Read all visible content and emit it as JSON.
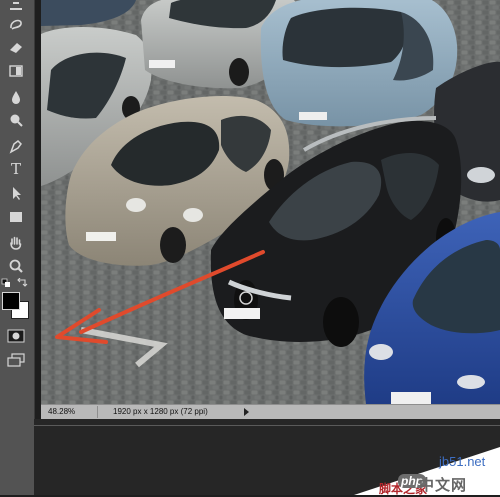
{
  "status_bar": {
    "zoom": "48.28%",
    "document_info": "1920 px x 1280 px (72 ppi)"
  },
  "toolbar": {
    "tools": [
      "move-icon",
      "lasso-icon",
      "brush-icon",
      "eraser-icon",
      "gradient-icon",
      "blur-drop-icon",
      "dodge-icon",
      "pen-icon",
      "type-icon",
      "path-select-icon",
      "rectangle-icon",
      "hand-icon",
      "zoom-icon",
      "default-colors-icon",
      "swap-colors-icon",
      "foreground-color-swatch",
      "background-color-swatch",
      "quick-mask-icon",
      "screen-mode-icon"
    ],
    "type_tool_label": "T",
    "foreground_color": "#000000",
    "background_color": "#ffffff"
  },
  "annotation": {
    "arrow_color": "#e04a2c"
  },
  "watermark": {
    "badge": "php",
    "site": "jb51.net",
    "site_cn": "中文网",
    "brand": "脚本之家"
  }
}
